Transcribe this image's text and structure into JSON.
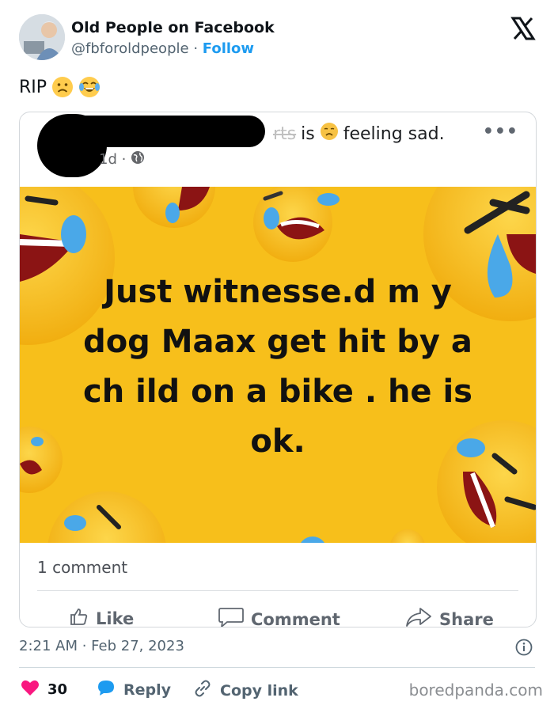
{
  "author": {
    "name": "Old People on Facebook",
    "handle": "@fbforoldpeople",
    "separator": "·",
    "follow_label": "Follow"
  },
  "tweet": {
    "text": "RIP",
    "emojis": [
      "slightly-frowning-face-emoji",
      "joy-emoji"
    ]
  },
  "embedded_post": {
    "status_struck": "rts",
    "status_is": "is",
    "status_text": "feeling sad.",
    "time": "1d ·",
    "image_text": [
      "Just witnesse.d m y",
      "dog Maax get hit by a",
      "ch ild on a bike . he is",
      "ok."
    ],
    "comments": "1 comment",
    "actions": {
      "like": "Like",
      "comment": "Comment",
      "share": "Share"
    }
  },
  "timestamp": "2:21 AM · Feb 27, 2023",
  "footer": {
    "likes": "30",
    "reply_label": "Reply",
    "copy_label": "Copy link"
  },
  "watermark": "boredpanda.com",
  "colors": {
    "accent_blue": "#1d9bf0",
    "like_red": "#f91880",
    "meme_yellow": "#f7bf1b"
  }
}
